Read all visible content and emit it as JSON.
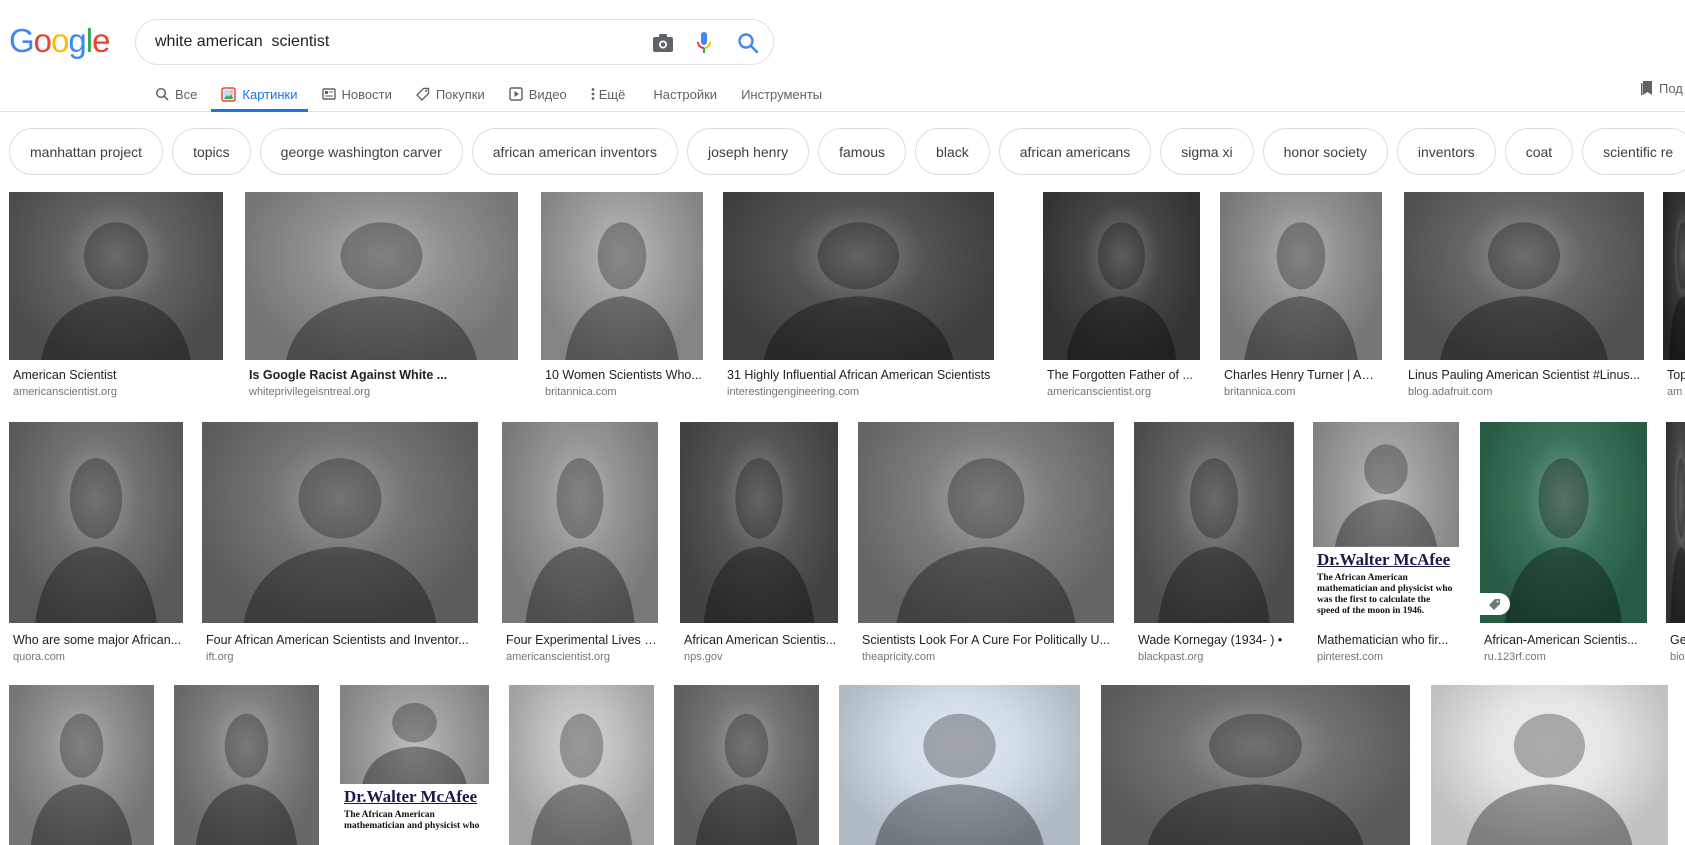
{
  "header": {
    "logo_letters": [
      {
        "char": "G",
        "color": "#4285f4"
      },
      {
        "char": "o",
        "color": "#ea4335"
      },
      {
        "char": "o",
        "color": "#fbbc05"
      },
      {
        "char": "g",
        "color": "#4285f4"
      },
      {
        "char": "l",
        "color": "#34a853"
      },
      {
        "char": "e",
        "color": "#ea4335"
      }
    ],
    "search_value": "white american  scientist",
    "icons": [
      "camera-icon",
      "microphone-icon",
      "search-icon"
    ]
  },
  "tabs": [
    {
      "label": "Все",
      "icon": "search-icon"
    },
    {
      "label": "Картинки",
      "icon": "image-icon",
      "active": true
    },
    {
      "label": "Новости",
      "icon": "news-icon"
    },
    {
      "label": "Покупки",
      "icon": "tag-icon"
    },
    {
      "label": "Видео",
      "icon": "play-icon"
    },
    {
      "label": "Ещё",
      "icon": "more-vert-icon"
    },
    {
      "label": "Настройки"
    },
    {
      "label": "Инструменты"
    }
  ],
  "saved_label": "Под",
  "chips": [
    "manhattan project",
    "topics",
    "george washington carver",
    "african american inventors",
    "joseph henry",
    "famous",
    "black",
    "african americans",
    "sigma xi",
    "honor society",
    "inventors",
    "coat",
    "scientific re"
  ],
  "results": {
    "row1": [
      {
        "title": "American Scientist",
        "source": "americanscientist.org",
        "tone": "#5a5a5a"
      },
      {
        "title": "Is Google Racist Against White ...",
        "source": "whiteprivilegeisntreal.org",
        "tone": "#8a8a8a",
        "bold": true
      },
      {
        "title": "10 Women Scientists Who...",
        "source": "britannica.com",
        "tone": "#9b9b9b"
      },
      {
        "title": "31 Highly Influential African American Scientists",
        "source": "interestingengineering.com",
        "tone": "#4a4a4a"
      },
      {
        "title": "The Forgotten Father of ...",
        "source": "americanscientist.org",
        "tone": "#3c3c3c"
      },
      {
        "title": "Charles Henry Turner | Am...",
        "source": "britannica.com",
        "tone": "#8c8c8c"
      },
      {
        "title": "Linus Pauling American Scientist #Linus...",
        "source": "blog.adafruit.com",
        "tone": "#5e5e5e"
      },
      {
        "title": "Top",
        "source": "am",
        "tone": "#2a2a2a"
      }
    ],
    "row2": [
      {
        "title": "Who are some major African...",
        "source": "quora.com",
        "tone": "#6a6a6a"
      },
      {
        "title": "Four African American Scientists and Inventor...",
        "source": "ift.org",
        "tone": "#6d6d6d"
      },
      {
        "title": "Four Experimental Lives | ...",
        "source": "americanscientist.org",
        "tone": "#8e8e8e"
      },
      {
        "title": "African American Scientis...",
        "source": "nps.gov",
        "tone": "#4d4d4d"
      },
      {
        "title": "Scientists Look For A Cure For Politically U...",
        "source": "theapricity.com",
        "tone": "#777777"
      },
      {
        "title": "Wade Kornegay (1934- ) •",
        "source": "blackpast.org",
        "tone": "#5a5a5a"
      },
      {
        "title": "Mathematician who fir...",
        "source": "pinterest.com",
        "tone": "#9a9a9a",
        "caption": "Dr.Walter McAfee",
        "subcaption": "The African American mathematician and physicist who was the first to calculate the speed of the moon in 1946."
      },
      {
        "title": "African-American Scientis...",
        "source": "ru.123rf.com",
        "tone": "#2e6b4f"
      },
      {
        "title": "Ge",
        "source": "bio",
        "tone": "#3a3a3a"
      }
    ],
    "row3": [
      {
        "tone": "#8a8a8a"
      },
      {
        "tone": "#7a7a7a"
      },
      {
        "tone": "#9a9a9a",
        "caption": "Dr.Walter McAfee",
        "subcaption": "The African American mathematician and physicist who"
      },
      {
        "tone": "#bdbdbd"
      },
      {
        "tone": "#6e6e6e"
      },
      {
        "tone": "#cfdbe6"
      },
      {
        "tone": "#6a6a6a"
      },
      {
        "tone": "#e4e4e4"
      }
    ]
  }
}
